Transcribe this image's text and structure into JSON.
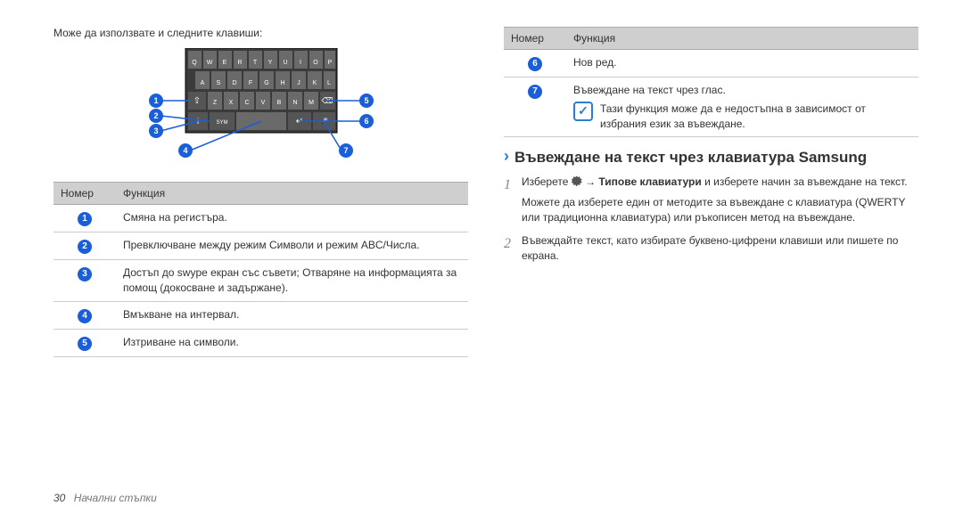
{
  "left": {
    "intro": "Може да използвате и следните клавиши:",
    "keyboard_rows": [
      [
        "Q",
        "W",
        "E",
        "R",
        "T",
        "Y",
        "U",
        "I",
        "O",
        "P"
      ],
      [
        "A",
        "S",
        "D",
        "F",
        "G",
        "H",
        "J",
        "K",
        "L"
      ],
      [
        "⇧",
        "Z",
        "X",
        "C",
        "V",
        "B",
        "N",
        "M",
        "⌫"
      ],
      [
        "i",
        "SYM",
        "␣",
        "↵",
        "🎤"
      ]
    ],
    "table": {
      "head_num": "Номер",
      "head_func": "Функция",
      "rows": [
        {
          "n": "1",
          "f": "Смяна на регистъра."
        },
        {
          "n": "2",
          "f": "Превключване между режим Символи и режим ABC/Числа."
        },
        {
          "n": "3",
          "f": "Достъп до swype екран със съвети; Отваряне на информацията за помощ (докосване и задържане)."
        },
        {
          "n": "4",
          "f": "Вмъкване на интервал."
        },
        {
          "n": "5",
          "f": "Изтриване на символи."
        }
      ]
    }
  },
  "right": {
    "table": {
      "head_num": "Номер",
      "head_func": "Функция",
      "rows": [
        {
          "n": "6",
          "f": "Нов ред."
        },
        {
          "n": "7",
          "f": "Въвеждане на текст чрез глас.",
          "note": "Тази функция може да е недостъпна в зависимост от избрания език за въвеждане."
        }
      ]
    },
    "section_title": "Въвеждане на текст чрез клавиатура Samsung",
    "step1_a": "Изберете ",
    "step1_b": " → ",
    "step1_bold": "Типове клавиатури",
    "step1_c": " и изберете начин за въвеждане на текст.",
    "step1_extra": "Можете да изберете един от методите за въвеждане с клавиатура (QWERTY или традиционна клавиатура) или ръкописен метод на въвеждане.",
    "step2": "Въвеждайте текст, като избирате буквено-цифрени клавиши или пишете по екрана."
  },
  "footer": {
    "page": "30",
    "label": "Начални стъпки"
  }
}
